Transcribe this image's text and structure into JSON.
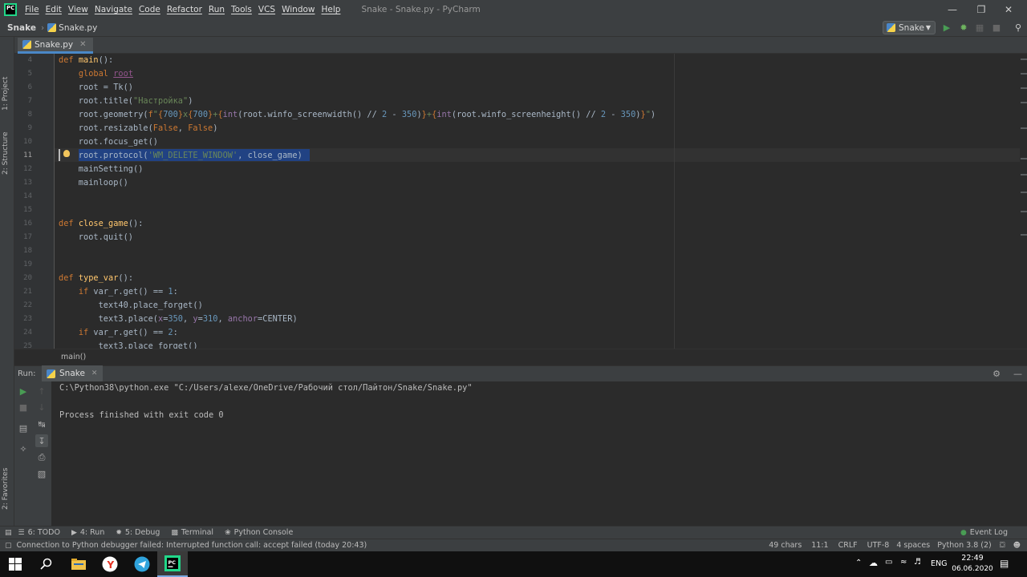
{
  "titlebar": {
    "menu": [
      "File",
      "Edit",
      "View",
      "Navigate",
      "Code",
      "Refactor",
      "Run",
      "Tools",
      "VCS",
      "Window",
      "Help"
    ],
    "title": "Snake - Snake.py - PyCharm",
    "logo_text": "PC"
  },
  "navbar": {
    "project": "Snake",
    "file": "Snake.py",
    "run_config": "Snake"
  },
  "left_strip": {
    "project": "1: Project",
    "structure": "2: Structure",
    "favorites": "2: Favorites"
  },
  "editor": {
    "tab_label": "Snake.py",
    "line_numbers": [
      "4",
      "5",
      "6",
      "7",
      "8",
      "9",
      "10",
      "11",
      "12",
      "13",
      "14",
      "15",
      "16",
      "17",
      "18",
      "19",
      "20",
      "21",
      "22",
      "23",
      "24",
      "25"
    ],
    "breadcrumb": "main()"
  },
  "run_panel": {
    "label": "Run:",
    "tab": "Snake",
    "output": [
      "C:\\Python38\\python.exe \"C:/Users/alexe/OneDrive/Рабочий стол/Пайтон/Snake/Snake.py\"",
      "",
      "Process finished with exit code 0"
    ]
  },
  "tool_windows": {
    "todo": "6: TODO",
    "run": "4: Run",
    "debug": "5: Debug",
    "terminal": "Terminal",
    "python_console": "Python Console",
    "event_log": "Event Log"
  },
  "status": {
    "message": "Connection to Python debugger failed: Interrupted function call: accept failed (today 20:43)",
    "chars": "49 chars",
    "position": "11:1",
    "line_sep": "CRLF",
    "encoding": "UTF-8",
    "indent": "4 spaces",
    "interpreter": "Python 3.8 (2)"
  },
  "taskbar": {
    "lang": "ENG",
    "time": "22:49",
    "date": "06.06.2020"
  },
  "colors": {
    "keyword": "#cc7832",
    "function": "#ffc66d",
    "string": "#6a8759",
    "number": "#6897bb",
    "selection": "#214283",
    "run_green": "#499c54"
  }
}
